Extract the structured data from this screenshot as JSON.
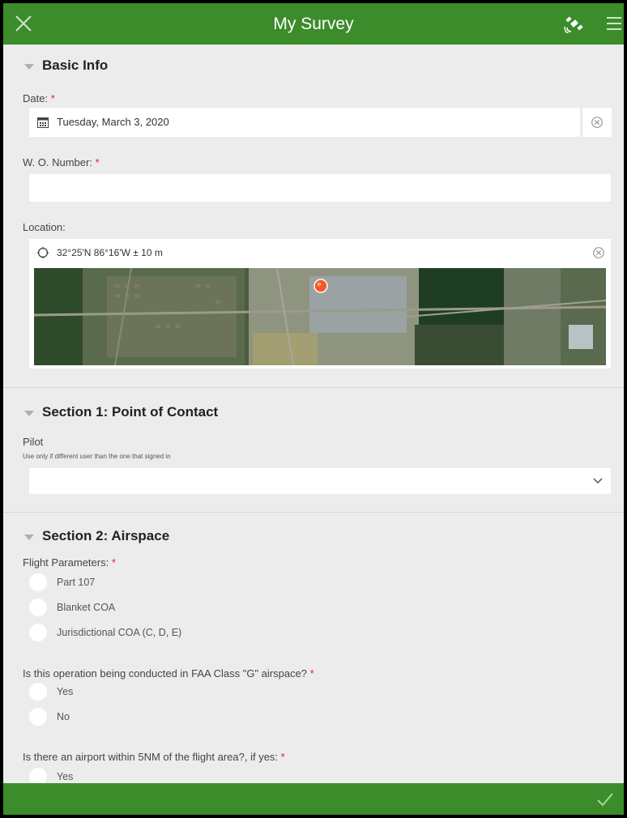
{
  "header": {
    "title": "My Survey",
    "close_icon": "close-icon",
    "gps_icon": "satellite-icon",
    "menu_icon": "hamburger-menu-icon"
  },
  "basic_info": {
    "heading": "Basic Info",
    "date_label": "Date:",
    "date_required": "*",
    "date_value": "Tuesday, March 3, 2020",
    "wo_label": "W. O. Number:",
    "wo_required": "*",
    "wo_value": "",
    "location_label": "Location:",
    "location_value": "32°25'N 86°16'W ± 10 m"
  },
  "section1": {
    "heading": "Section 1: Point of Contact",
    "pilot_label": "Pilot",
    "pilot_hint": "Use only if different user than the one that signed in",
    "pilot_value": ""
  },
  "section2": {
    "heading": "Section 2: Airspace",
    "flight_params_label": "Flight Parameters:",
    "flight_params_required": "*",
    "flight_options": [
      "Part 107",
      "Blanket COA",
      "Jurisdictional COA (C, D, E)"
    ],
    "q_class_g": "Is this operation being conducted in FAA Class \"G\" airspace?",
    "q_class_g_required": "*",
    "q_class_g_options": [
      "Yes",
      "No"
    ],
    "q_airport": "Is there an airport within 5NM of the flight area?, if yes:",
    "q_airport_required": "*",
    "q_airport_options": [
      "Yes"
    ]
  },
  "footer": {
    "submit_icon": "checkmark-icon"
  },
  "colors": {
    "brand_green": "#3c8c2b",
    "required_red": "#d6223b",
    "location_pin": "#f05a28"
  }
}
